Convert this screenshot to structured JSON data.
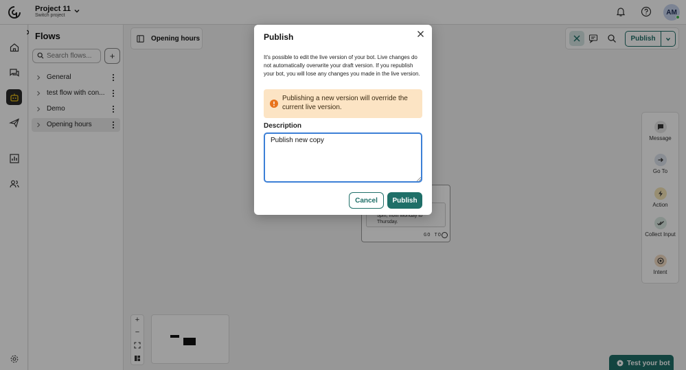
{
  "project": {
    "name": "Project 11",
    "switch_label": "Switch project"
  },
  "user": {
    "initials": "AM"
  },
  "flows_panel": {
    "title": "Flows",
    "search_placeholder": "Search flows...",
    "add_symbol": "+",
    "items": [
      {
        "label": "General"
      },
      {
        "label": "test flow with con..."
      },
      {
        "label": "Demo"
      },
      {
        "label": "Opening hours"
      }
    ]
  },
  "canvas": {
    "flow_title": "Opening hours",
    "node_text": "5pm, from Monday to Thursday.",
    "node_goto": "GO TO",
    "zoom_in": "+",
    "zoom_out": "−"
  },
  "toolbar": {
    "publish_label": "Publish"
  },
  "palette": {
    "items": [
      {
        "label": "Message",
        "icon": "message-icon"
      },
      {
        "label": "Go To",
        "icon": "arrow-right-icon"
      },
      {
        "label": "Action",
        "icon": "lightning-icon"
      },
      {
        "label": "Collect Input",
        "icon": "double-check-icon"
      },
      {
        "label": "Intent",
        "icon": "target-icon"
      }
    ]
  },
  "test_bot": {
    "label": "Test your bot"
  },
  "modal": {
    "title": "Publish",
    "body": "It's possible to edit the live version of your bot. Live changes do not automatically overwrite your draft version. If you republish your bot, you will lose any changes you made in the live version.",
    "warning": "Publishing a new version will override the current live version.",
    "description_label": "Description",
    "description_value": "Publish new copy",
    "cancel_label": "Cancel",
    "publish_label": "Publish"
  },
  "colors": {
    "brand": "#1f6f68",
    "warning_bg": "#fce4c4",
    "warning_icon": "#e8731c",
    "focus": "#3b7fd6"
  }
}
